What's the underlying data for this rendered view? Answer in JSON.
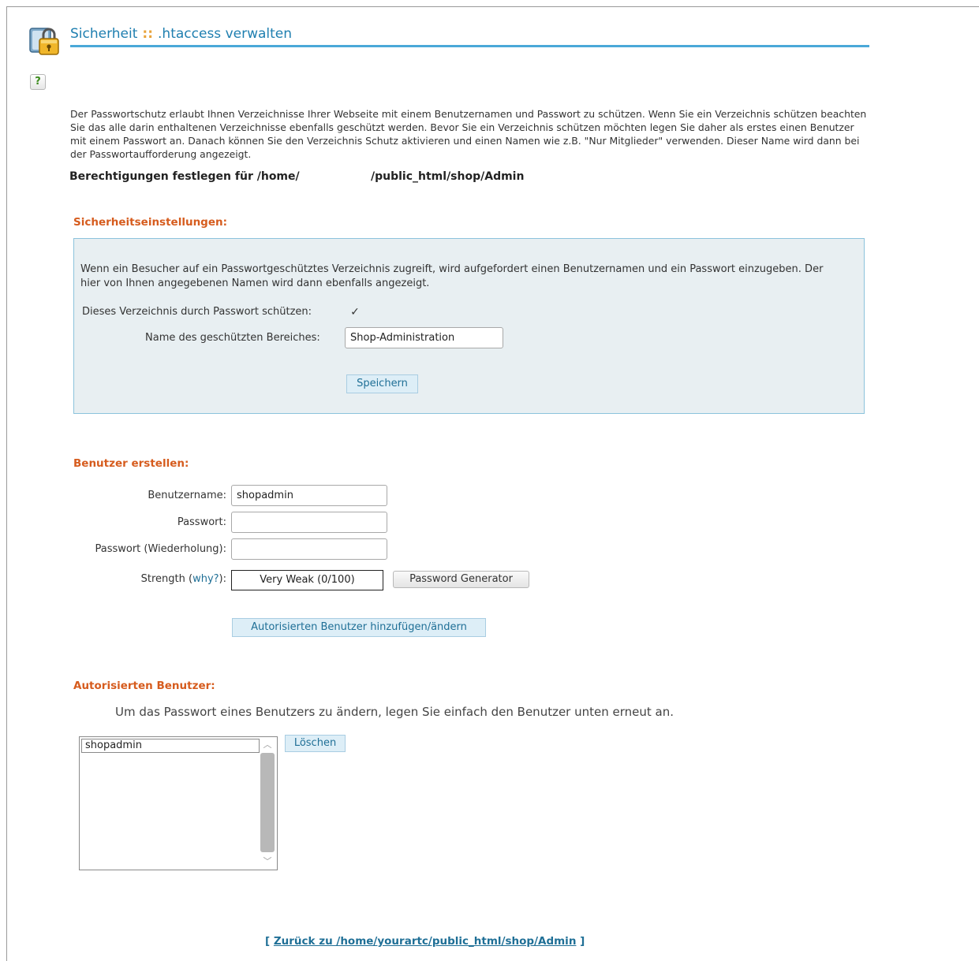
{
  "header": {
    "section": "Sicherheit",
    "separator": "::",
    "title": ".htaccess verwalten"
  },
  "icons": {
    "lock": "lock-icon",
    "help": "help-icon",
    "help_glyph": "?"
  },
  "intro_text": "Der Passwortschutz erlaubt Ihnen Verzeichnisse Ihrer Webseite mit einem Benutzernamen und Passwort zu schützen. Wenn Sie ein Verzeichnis schützen beachten Sie das alle darin enthaltenen Verzeichnisse ebenfalls geschützt werden. Bevor Sie ein Verzeichnis schützen möchten legen Sie daher als erstes einen Benutzer mit einem Passwort an. Danach können Sie den Verzeichnis Schutz aktivieren und einen Namen wie z.B. \"Nur Mitglieder\" verwenden. Dieser Name wird dann bei der Passwortaufforderung angezeigt.",
  "permissions": {
    "label": "Berechtigungen festlegen für /home/",
    "path": "/public_html/shop/Admin"
  },
  "security_settings": {
    "title": "Sicherheitseinstellungen:",
    "description": "Wenn ein Besucher auf ein Passwortgeschütztes Verzeichnis zugreift, wird aufgefordert einen Benutzernamen und ein Passwort einzugeben. Der hier von Ihnen angegebenen Namen wird dann ebenfalls angezeigt.",
    "protect_label": "Dieses Verzeichnis durch Passwort schützen:",
    "protect_checked": true,
    "checkmark_glyph": "✓",
    "area_name_label": "Name des geschützten Bereiches:",
    "area_name_value": "Shop-Administration",
    "save_button": "Speichern"
  },
  "create_user": {
    "title": "Benutzer erstellen:",
    "username_label": "Benutzername:",
    "username_value": "shopadmin",
    "password_label": "Passwort:",
    "password_value": "",
    "password_repeat_label": "Passwort (Wiederholung):",
    "password_repeat_value": "",
    "strength_label_prefix": "Strength (",
    "strength_why_link": "why?",
    "strength_label_suffix": "):",
    "strength_value": "Very Weak (0/100)",
    "generator_button": "Password Generator",
    "add_button": "Autorisierten Benutzer hinzufügen/ändern"
  },
  "authorized_users": {
    "title": "Autorisierten Benutzer:",
    "hint": "Um das Passwort eines Benutzers zu ändern, legen Sie einfach den Benutzer unten erneut an.",
    "users": [
      "shopadmin"
    ],
    "delete_button": "Löschen",
    "scroll_up_glyph": "︿",
    "scroll_down_glyph": "﹀"
  },
  "back_link": {
    "open": "[",
    "text": "Zurück zu /home/yourartc/public_html/shop/Admin",
    "close": "]"
  }
}
